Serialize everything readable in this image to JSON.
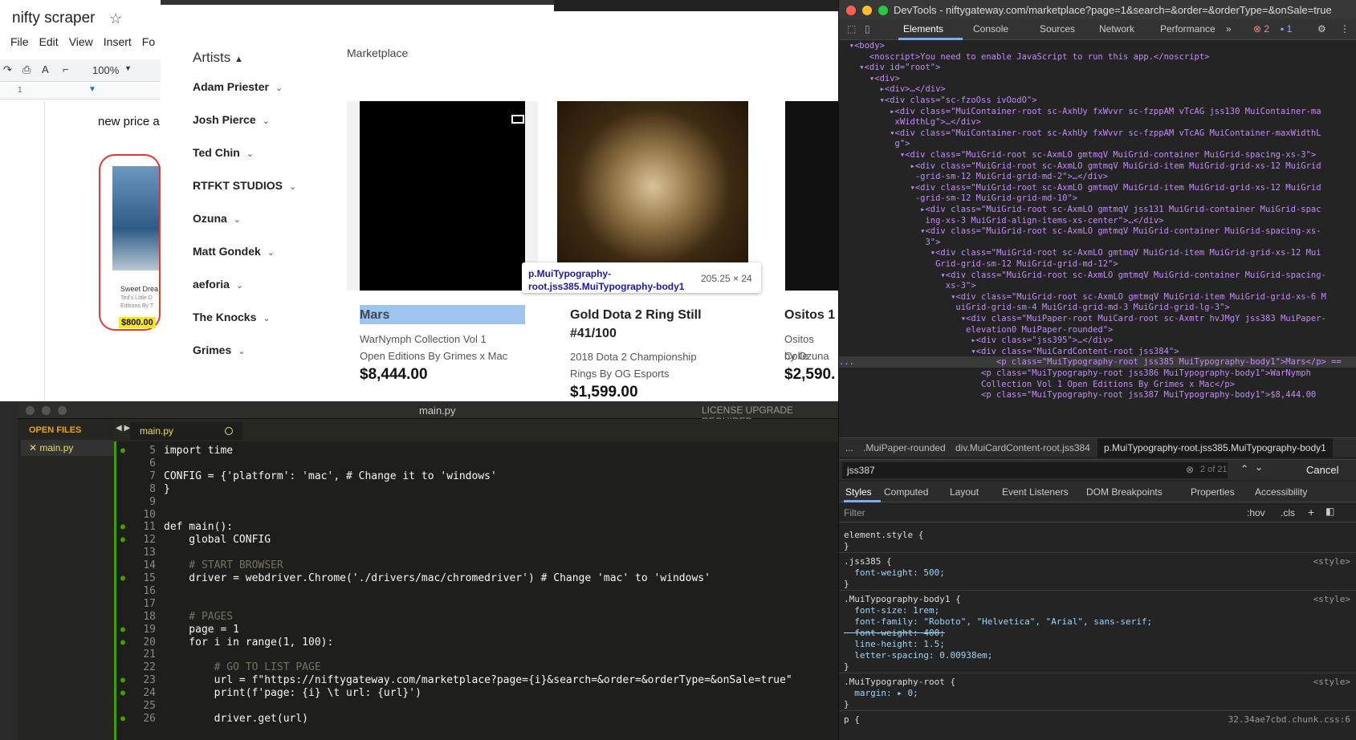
{
  "docs": {
    "title": "nifty scraper",
    "menu": [
      "File",
      "Edit",
      "View",
      "Insert",
      "Fo"
    ],
    "zoom": "100%",
    "line": "new price a",
    "card_title": "Sweet Drea",
    "card_sub": "Ted's Little D Editions By T",
    "card_price": "$800.00"
  },
  "marketplace": {
    "breadcrumb": "Marketplace",
    "artists_heading": "Artists",
    "artists": [
      "Adam Priester",
      "Josh Pierce",
      "Ted Chin",
      "RTFKT STUDIOS",
      "Ozuna",
      "Matt Gondek",
      "aeforia",
      "The Knocks",
      "Grimes"
    ],
    "cards": [
      {
        "name": "Mars",
        "sub1": "WarNymph Collection Vol 1",
        "sub2": "Open Editions By Grimes x Mac",
        "price": "$8,444.00"
      },
      {
        "name": "Gold Dota 2 Ring Still",
        "name2": "#41/100",
        "sub1": "2018 Dota 2 Championship",
        "sub2": "Rings By OG Esports",
        "price": "$1,599.00"
      },
      {
        "name": "Ositos 1",
        "sub1": "Ositos Colle",
        "sub2": "by Ozuna",
        "price": "$2,590."
      }
    ],
    "tooltip": {
      "selector": "p.MuiTypography-root.jss385.MuiTypography-body1",
      "dims": "205.25 × 24"
    }
  },
  "editor": {
    "window_title": "main.py",
    "license": "LICENSE UPGRADE REQUIRED",
    "open_files_label": "OPEN FILES",
    "sidebar_file": "✕ main.py",
    "tab": "main.py",
    "lines": [
      {
        "n": "5",
        "mod": true,
        "text": "import time"
      },
      {
        "n": "6",
        "mod": false,
        "text": ""
      },
      {
        "n": "7",
        "mod": false,
        "text": "CONFIG = {'platform': 'mac', # Change it to 'windows'"
      },
      {
        "n": "8",
        "mod": false,
        "text": "}"
      },
      {
        "n": "9",
        "mod": false,
        "text": ""
      },
      {
        "n": "10",
        "mod": false,
        "text": ""
      },
      {
        "n": "11",
        "mod": true,
        "text": "def main():"
      },
      {
        "n": "12",
        "mod": true,
        "text": "    global CONFIG"
      },
      {
        "n": "13",
        "mod": false,
        "text": ""
      },
      {
        "n": "14",
        "mod": false,
        "text": "    # START BROWSER"
      },
      {
        "n": "15",
        "mod": true,
        "text": "    driver = webdriver.Chrome('./drivers/mac/chromedriver') # Change 'mac' to 'windows'"
      },
      {
        "n": "16",
        "mod": false,
        "text": ""
      },
      {
        "n": "17",
        "mod": false,
        "text": ""
      },
      {
        "n": "18",
        "mod": false,
        "text": "    # PAGES"
      },
      {
        "n": "19",
        "mod": true,
        "text": "    page = 1"
      },
      {
        "n": "20",
        "mod": true,
        "text": "    for i in range(1, 100):"
      },
      {
        "n": "21",
        "mod": false,
        "text": ""
      },
      {
        "n": "22",
        "mod": false,
        "text": "        # GO TO LIST PAGE"
      },
      {
        "n": "23",
        "mod": true,
        "text": "        url = f\"https://niftygateway.com/marketplace?page={i}&search=&order=&orderType=&onSale=true\""
      },
      {
        "n": "24",
        "mod": true,
        "text": "        print(f'page: {i} \\t url: {url}')"
      },
      {
        "n": "25",
        "mod": false,
        "text": ""
      },
      {
        "n": "26",
        "mod": true,
        "text": "        driver.get(url)"
      }
    ]
  },
  "devtools": {
    "title": "DevTools - niftygateway.com/marketplace?page=1&search=&order=&orderType=&onSale=true",
    "tabs": [
      "Elements",
      "Console",
      "Sources",
      "Network",
      "Performance",
      "»"
    ],
    "errors": "2",
    "messages": "1",
    "dom_lines": [
      "  ▾<body>",
      "      <noscript>You need to enable JavaScript to run this app.</noscript>",
      "    ▾<div id=\"root\">",
      "      ▾<div>",
      "        ▸<div>…</div>",
      "        ▾<div class=\"sc-fzoOss ivOodO\">",
      "          ▸<div class=\"MuiContainer-root sc-AxhUy fxWvvr sc-fzppAM vTcAG jss130 MuiContainer-ma",
      "           xWidthLg\">…</div>",
      "          ▾<div class=\"MuiContainer-root sc-AxhUy fxWvvr sc-fzppAM vTcAG MuiContainer-maxWidthL",
      "           g\">",
      "            ▾<div class=\"MuiGrid-root sc-AxmLO gmtmqV MuiGrid-container MuiGrid-spacing-xs-3\">",
      "              ▸<div class=\"MuiGrid-root sc-AxmLO gmtmqV MuiGrid-item MuiGrid-grid-xs-12 MuiGrid",
      "               -grid-sm-12 MuiGrid-grid-md-2\">…</div>",
      "              ▾<div class=\"MuiGrid-root sc-AxmLO gmtmqV MuiGrid-item MuiGrid-grid-xs-12 MuiGrid",
      "               -grid-sm-12 MuiGrid-grid-md-10\">",
      "                ▸<div class=\"MuiGrid-root sc-AxmLO gmtmqV jss131 MuiGrid-container MuiGrid-spac",
      "                 ing-xs-3 MuiGrid-align-items-xs-center\">…</div>",
      "                ▾<div class=\"MuiGrid-root sc-AxmLO gmtmqV MuiGrid-container MuiGrid-spacing-xs-",
      "                 3\">",
      "                  ▾<div class=\"MuiGrid-root sc-AxmLO gmtmqV MuiGrid-item MuiGrid-grid-xs-12 Mui",
      "                   Grid-grid-sm-12 MuiGrid-grid-md-12\">",
      "                    ▾<div class=\"MuiGrid-root sc-AxmLO gmtmqV MuiGrid-container MuiGrid-spacing-",
      "                     xs-3\">",
      "                      ▾<div class=\"MuiGrid-root sc-AxmLO gmtmqV MuiGrid-item MuiGrid-grid-xs-6 M",
      "                       uiGrid-grid-sm-4 MuiGrid-grid-md-3 MuiGrid-grid-lg-3\">",
      "                        ▾<div class=\"MuiPaper-root MuiCard-root sc-Axmtr hvJMgY jss383 MuiPaper-",
      "                         elevation0 MuiPaper-rounded\">",
      "                          ▸<div class=\"jss395\">…</div>",
      "                          ▾<div class=\"MuiCardContent-root jss384\">",
      "...                            <p class=\"MuiTypography-root jss385 MuiTypography-body1\">Mars</p> ==",
      "                            <p class=\"MuiTypography-root jss386 MuiTypography-body1\">WarNymph",
      "                            Collection Vol 1 Open Editions By Grimes x Mac</p>",
      "                            <p class=\"MuiTypography-root jss387 MuiTypography-body1\">$8,444.00"
    ],
    "crumbs": [
      "...",
      ".MuiPaper-rounded",
      "div.MuiCardContent-root.jss384",
      "p.MuiTypography-root.jss385.MuiTypography-body1"
    ],
    "search_value": "jss387",
    "search_count": "2 of 21",
    "cancel": "Cancel",
    "subtabs": [
      "Styles",
      "Computed",
      "Layout",
      "Event Listeners",
      "DOM Breakpoints",
      "Properties",
      "Accessibility"
    ],
    "filter_placeholder": "Filter",
    "hov": ":hov",
    "cls": ".cls",
    "style_rules": [
      "element.style {",
      "}",
      ".jss385 {",
      "  font-weight: 500;",
      "}",
      ".MuiTypography-body1 {",
      "  font-size: 1rem;",
      "  font-family: \"Roboto\", \"Helvetica\", \"Arial\", sans-serif;",
      "  font-weight: 400;",
      "  line-height: 1.5;",
      "  letter-spacing: 0.00938em;",
      "}",
      ".MuiTypography-root {",
      "  margin: ▸ 0;",
      "}",
      "p {"
    ],
    "style_src": "<style>",
    "style_src_last": "32.34ae7cbd.chunk.css:6"
  }
}
